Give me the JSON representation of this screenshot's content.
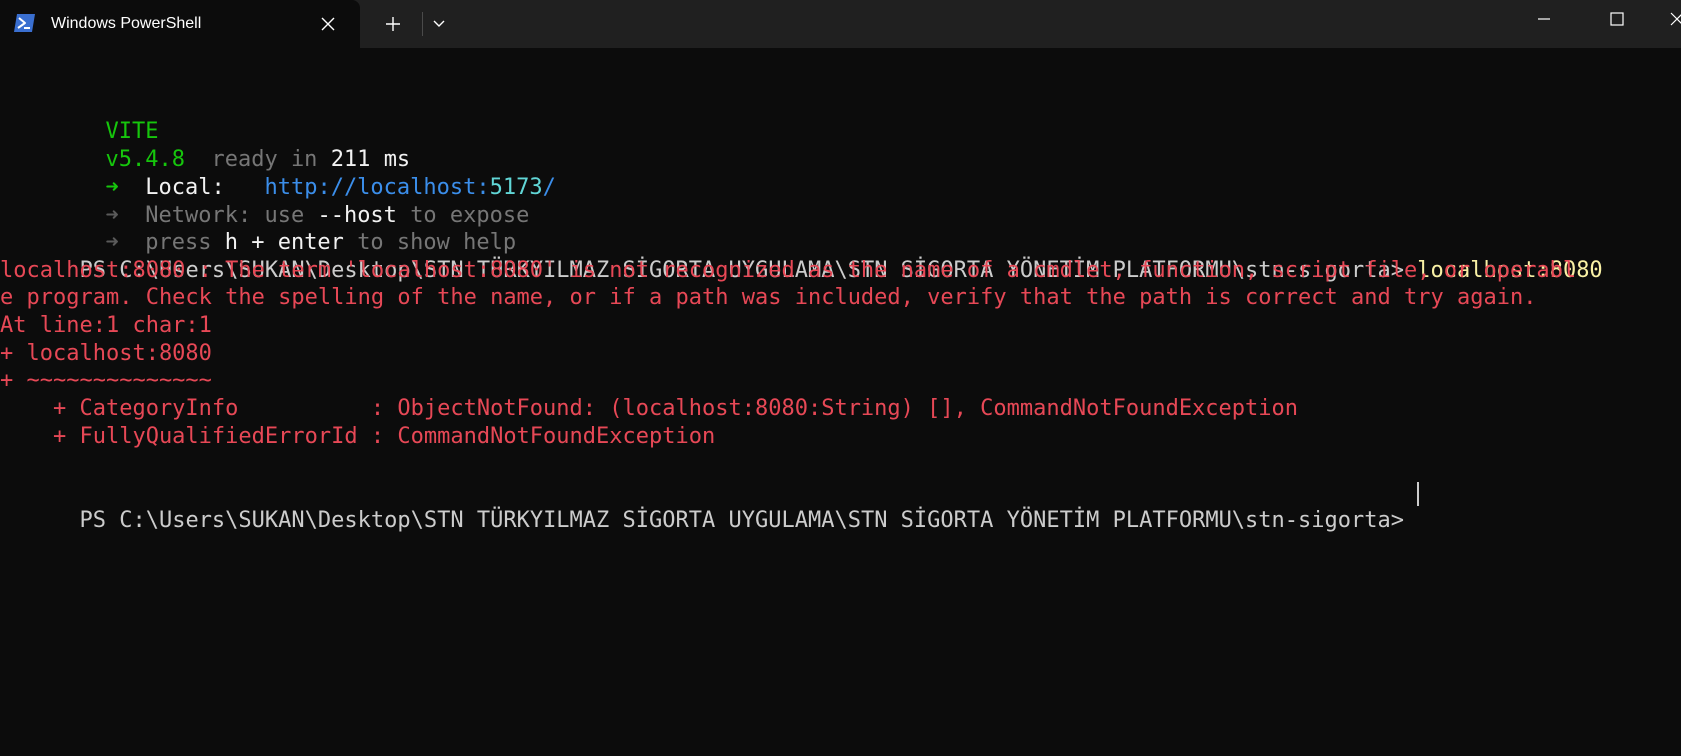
{
  "window": {
    "tab_title": "Windows PowerShell",
    "icons": {
      "tab": "powershell-icon",
      "close": "close-icon",
      "new_tab": "plus-icon",
      "dropdown": "chevron-down-icon",
      "minimize": "minimize-icon",
      "maximize": "maximize-icon",
      "window_close": "close-icon"
    }
  },
  "colors": {
    "background": "#0c0c0c",
    "titlebar": "#202020",
    "green": "#16c60c",
    "blue": "#3b8eea",
    "cyan": "#61d6d6",
    "yellow": "#f9f1a5",
    "red": "#e74856",
    "gray": "#767676"
  },
  "terminal": {
    "vite": {
      "name": "VITE",
      "version": "v5.4.8",
      "ready_label": "ready in",
      "ready_time": "211",
      "ready_unit": "ms"
    },
    "local": {
      "arrow": "➜",
      "label": "Local:",
      "url_prefix": "http://localhost:",
      "url_port": "5173",
      "url_suffix": "/"
    },
    "network": {
      "arrow": "➜",
      "label": "Network:",
      "text_before": "use",
      "flag": "--host",
      "text_after": "to expose"
    },
    "help": {
      "arrow": "➜",
      "press": "press",
      "keys": "h + enter",
      "text_after": "to show help"
    },
    "prompt_path": "PS C:\\Users\\SUKAN\\Desktop\\STN TÜRKYILMAZ SİGORTA UYGULAMA\\STN SİGORTA YÖNETİM PLATFORMU\\stn-sigorta>",
    "command": "localhost:8080",
    "error_lines": [
      "localhost:8080 : The term 'localhost:8080' is not recognized as the name of a cmdlet, function, script file, or operabl",
      "e program. Check the spelling of the name, or if a path was included, verify that the path is correct and try again.",
      "At line:1 char:1",
      "+ localhost:8080",
      "+ ~~~~~~~~~~~~~~",
      "    + CategoryInfo          : ObjectNotFound: (localhost:8080:String) [], CommandNotFoundException",
      "    + FullyQualifiedErrorId : CommandNotFoundException"
    ],
    "final_prompt": "PS C:\\Users\\SUKAN\\Desktop\\STN TÜRKYILMAZ SİGORTA UYGULAMA\\STN SİGORTA YÖNETİM PLATFORMU\\stn-sigorta>"
  }
}
